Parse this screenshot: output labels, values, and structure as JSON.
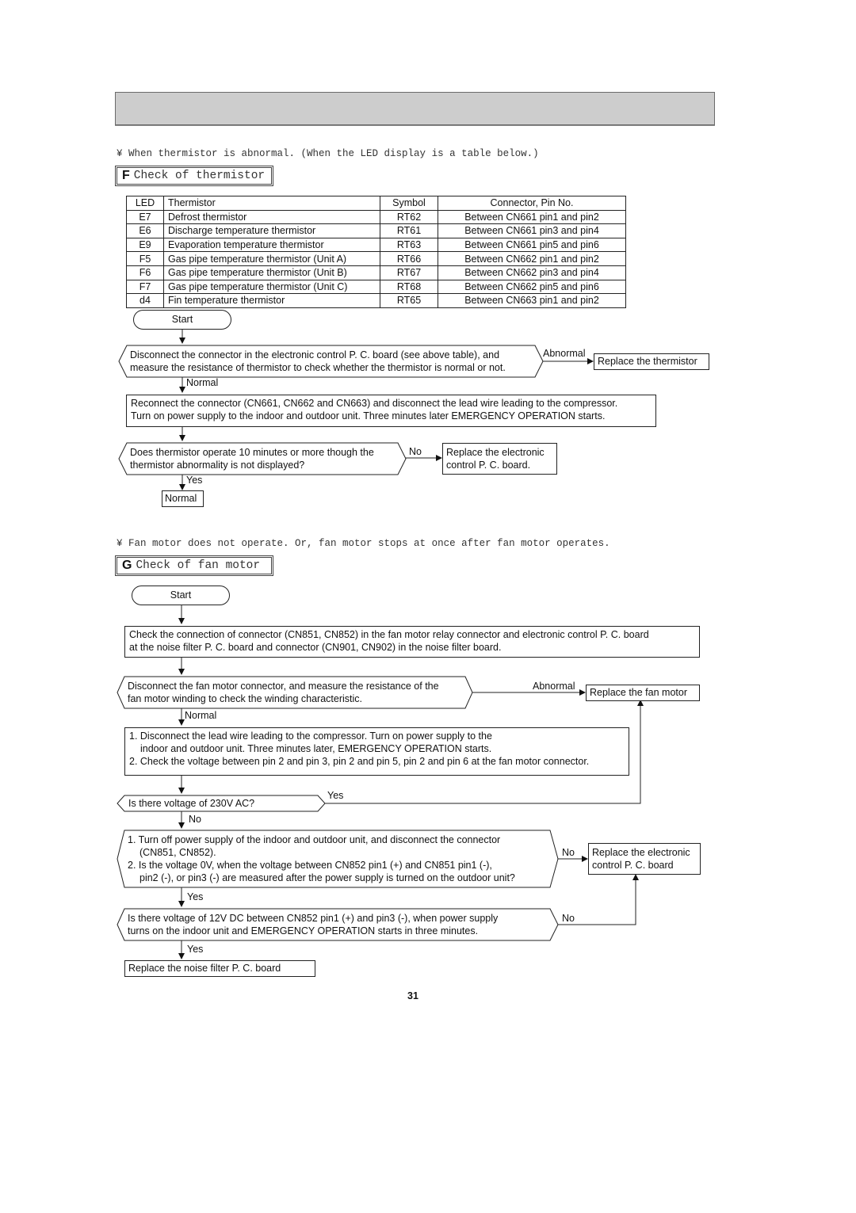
{
  "page": {
    "page_number": "31",
    "bullet_glyph": "¥"
  },
  "section_f": {
    "note": "¥ When thermistor is abnormal. (When the LED display is a table below.)",
    "letter": "F",
    "title": "Check of thermistor",
    "table": {
      "headers": [
        "LED",
        "Thermistor",
        "Symbol",
        "Connector, Pin No."
      ],
      "rows": [
        [
          "E7",
          "Defrost thermistor",
          "RT62",
          "Between CN661 pin1 and pin2"
        ],
        [
          "E6",
          "Discharge temperature thermistor",
          "RT61",
          "Between CN661 pin3 and pin4"
        ],
        [
          "E9",
          "Evaporation temperature thermistor",
          "RT63",
          "Between CN661 pin5 and pin6"
        ],
        [
          "F5",
          "Gas pipe temperature thermistor (Unit A)",
          "RT66",
          "Between CN662 pin1 and pin2"
        ],
        [
          "F6",
          "Gas pipe temperature thermistor (Unit B)",
          "RT67",
          "Between CN662 pin3 and pin4"
        ],
        [
          "F7",
          "Gas pipe temperature thermistor (Unit C)",
          "RT68",
          "Between CN662 pin5 and pin6"
        ],
        [
          "d4",
          "Fin temperature thermistor",
          "RT65",
          "Between CN663 pin1 and pin2"
        ]
      ]
    },
    "flow": {
      "start": "Start",
      "decision1_line1": "Disconnect the connector in the electronic control P. C. board (see above table), and",
      "decision1_line2": "measure the resistance of thermistor to check whether the thermistor is normal or not.",
      "abnormal_label": "Abnormal",
      "replace_thermistor": "Replace the thermistor",
      "normal_label": "Normal",
      "step2_line1": "Reconnect the connector (CN661, CN662 and CN663) and disconnect the lead wire leading to the compressor.",
      "step2_line2": "Turn on power supply to the indoor and outdoor unit. Three minutes later EMERGENCY OPERATION starts.",
      "decision2_line1": "Does thermistor operate 10 minutes or more though the",
      "decision2_line2": "thermistor abnormality is not displayed?",
      "no_label": "No",
      "replace_board_line1": "Replace the electronic",
      "replace_board_line2": "control P. C. board.",
      "yes_label": "Yes",
      "normal_result": "Normal"
    }
  },
  "section_g": {
    "note": "¥ Fan motor does not operate. Or, fan motor stops at once after fan motor operates.",
    "letter": "G",
    "title": "Check of fan motor",
    "flow": {
      "start": "Start",
      "step1_line1": "Check the connection of connector (CN851, CN852) in the fan motor relay connector and electronic control P. C. board",
      "step1_line2": "at the noise filter P. C. board and connector (CN901, CN902) in the noise filter board.",
      "decision1_line1": "Disconnect the fan motor connector, and measure the resistance of the",
      "decision1_line2": "fan motor winding to check the winding characteristic.",
      "abnormal_label": "Abnormal",
      "replace_fan_motor": "Replace the fan motor",
      "normal_label": "Normal",
      "step2_line1": "1. Disconnect the lead wire leading to the compressor. Turn on power supply to the",
      "step2_line2": "indoor and outdoor unit. Three minutes later, EMERGENCY OPERATION starts.",
      "step2_line3": "2. Check the voltage between pin 2 and pin 3, pin 2 and pin 5, pin 2 and pin 6 at the fan motor connector.",
      "decision2": "Is there voltage of 230V AC?",
      "yes_label_1": "Yes",
      "no_label_1": "No",
      "decision3_line1": "1. Turn off power supply of the indoor and outdoor unit, and disconnect the connector",
      "decision3_line2": "(CN851, CN852).",
      "decision3_line3": "2. Is the voltage 0V, when the voltage between CN852 pin1 (+) and CN851 pin1 (-),",
      "decision3_line4": "pin2 (-), or pin3 (-) are measured after the power supply is turned on the outdoor unit?",
      "no_label_2": "No",
      "replace_board_line1": "Replace the electronic",
      "replace_board_line2": "control P. C. board",
      "yes_label_2": "Yes",
      "decision4_line1": "Is there voltage of 12V DC between CN852 pin1 (+) and pin3 (-), when power supply",
      "decision4_line2": "turns on the indoor unit and EMERGENCY OPERATION starts in three minutes.",
      "no_label_3": "No",
      "yes_label_3": "Yes",
      "replace_noise_filter": "Replace the noise filter P. C. board"
    }
  }
}
